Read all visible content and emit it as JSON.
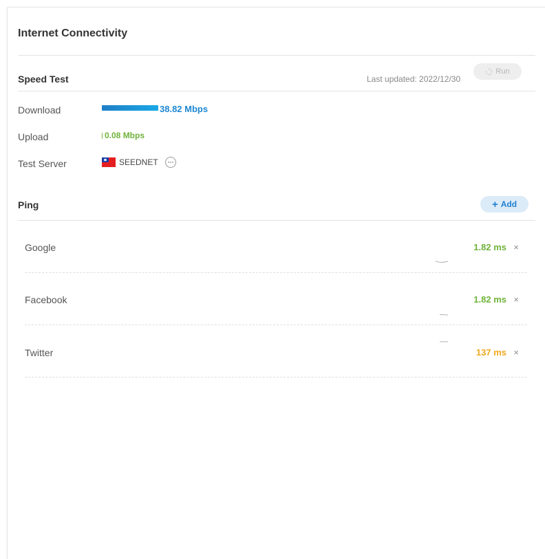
{
  "header": {
    "title": "Internet Connectivity"
  },
  "speed_test": {
    "title": "Speed Test",
    "last_updated": "Last updated: 2022/12/30",
    "run_label": "Run",
    "run_icon": "spinner-icon",
    "download_label": "Download",
    "download_value": "38.82 Mbps",
    "download_mbps": 38.82,
    "upload_label": "Upload",
    "upload_value": "0.08 Mbps",
    "upload_mbps": 0.08,
    "server_label": "Test Server",
    "server_flag": "taiwan-flag-icon",
    "server_name": "SEEDNET",
    "more_icon": "more-icon"
  },
  "ping": {
    "title": "Ping",
    "add_label": "Add",
    "add_icon": "plus-icon",
    "close_icon": "close-icon",
    "targets": [
      {
        "name": "Google",
        "value": "1.82 ms",
        "status_color": "#6fb33a"
      },
      {
        "name": "Facebook",
        "value": "1.82 ms",
        "status_color": "#6fb33a"
      },
      {
        "name": "Twitter",
        "value": "137 ms",
        "status_color": "#f0a81e"
      }
    ],
    "close_symbol": "×"
  },
  "colors": {
    "download": "#1e88d2",
    "upload": "#6fb33a",
    "accent": "#1e7fcf",
    "warning": "#f0a81e"
  }
}
